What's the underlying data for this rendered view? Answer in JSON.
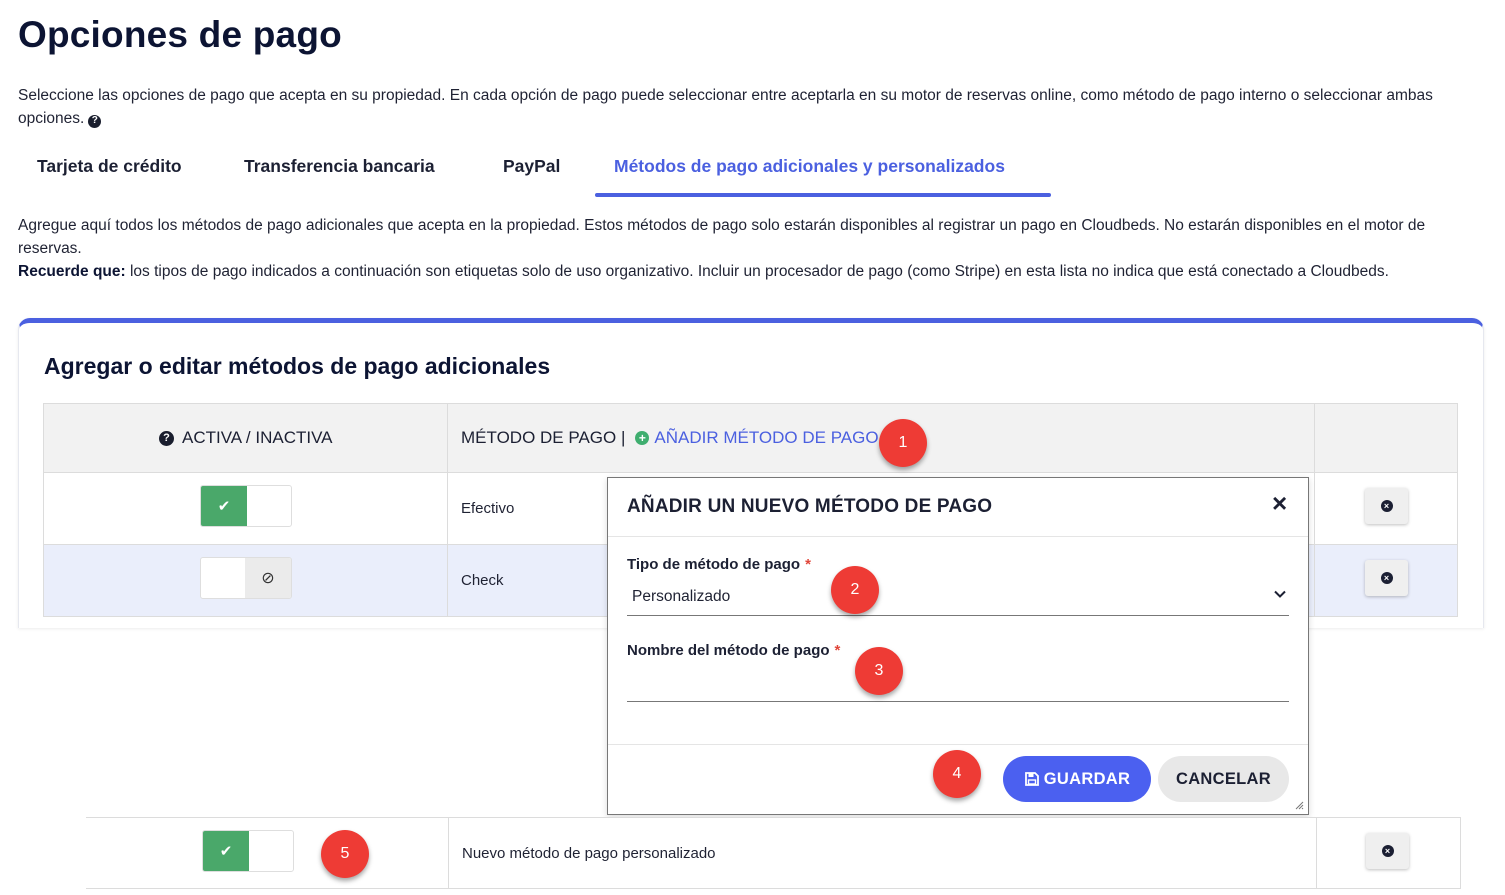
{
  "page": {
    "title": "Opciones de pago",
    "intro": "Seleccione las opciones de pago que acepta en su propiedad. En cada opción de pago puede seleccionar entre aceptarla en su motor de reservas online, como método de pago interno o seleccionar ambas opciones."
  },
  "tabs": [
    {
      "label": "Tarjeta de crédito",
      "active": false
    },
    {
      "label": "Transferencia bancaria",
      "active": false
    },
    {
      "label": "PayPal",
      "active": false
    },
    {
      "label": "Métodos de pago adicionales y personalizados",
      "active": true
    }
  ],
  "description": {
    "line1": "Agregue aquí todos los métodos de pago adicionales que acepta en la propiedad. Estos métodos de pago solo estarán disponibles al registrar un pago en Cloudbeds. No estarán disponibles en el motor de reservas.",
    "remember_label": "Recuerde que:",
    "remember_text": " los tipos de pago indicados a continuación son etiquetas solo de uso organizativo. Incluir un procesador de pago (como Stripe) en esta lista no indica que está conectado a Cloudbeds."
  },
  "card": {
    "title": "Agregar o editar métodos de pago adicionales"
  },
  "table": {
    "col_active": "ACTIVA / INACTIVA",
    "col_method": "MÉTODO DE PAGO |",
    "add_link": "AÑADIR MÉTODO DE PAGO",
    "rows": [
      {
        "name": "Efectivo",
        "active": true
      },
      {
        "name": "Check",
        "active": false
      }
    ],
    "new_row": {
      "name": "Nuevo método de pago personalizado",
      "active": true
    }
  },
  "modal": {
    "title": "AÑADIR UN NUEVO MÉTODO DE PAGO",
    "type_label": "Tipo de método de pago",
    "type_value": "Personalizado",
    "name_label": "Nombre del método de pago",
    "name_value": "",
    "required_mark": "*",
    "save_label": "GUARDAR",
    "cancel_label": "CANCELAR"
  },
  "badges": [
    "1",
    "2",
    "3",
    "4",
    "5"
  ],
  "colors": {
    "accent": "#4b60e0",
    "toggle_on": "#4aa86a",
    "badge": "#ee3b35",
    "alt_row": "#eaeefb"
  }
}
